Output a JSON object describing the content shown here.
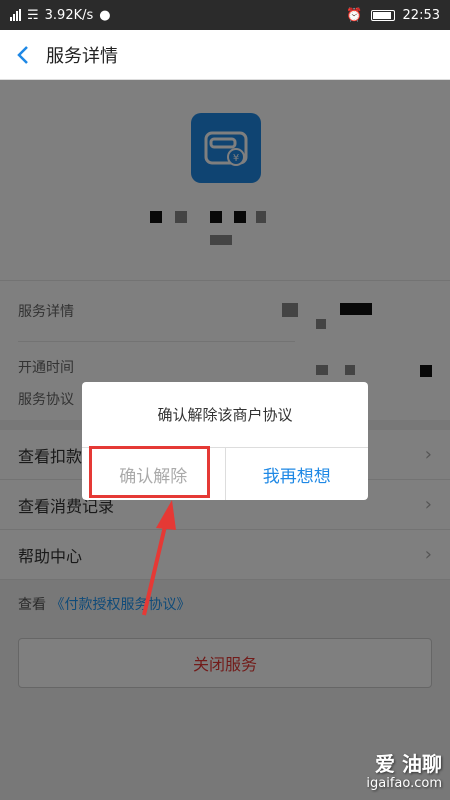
{
  "statusbar": {
    "speed": "3.92K/s",
    "time": "22:53"
  },
  "nav": {
    "title": "服务详情"
  },
  "info": {
    "label_detail": "服务详情",
    "label_open_time": "开通时间",
    "label_agreement": "服务协议"
  },
  "rows": [
    {
      "label": "查看扣款"
    },
    {
      "label": "查看消费记录"
    },
    {
      "label": "帮助中心"
    }
  ],
  "agreement_line": {
    "prefix": "查看",
    "link": "《付款授权服务协议》"
  },
  "close_button": "关闭服务",
  "dialog": {
    "message": "确认解除该商户协议",
    "confirm": "确认解除",
    "cancel": "我再想想"
  },
  "watermark": {
    "brand": "爱 油聊",
    "url": "igaifao.com"
  },
  "colors": {
    "accent": "#1e88e5",
    "danger": "#e53935",
    "overlay": "rgba(0,0,0,0.5)"
  }
}
